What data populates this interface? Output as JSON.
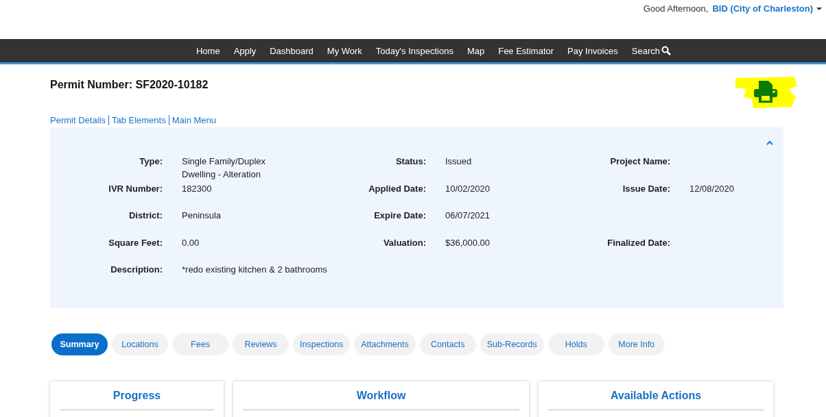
{
  "greeting": {
    "text": "Good Afternoon,",
    "user": "BID (City of Charleston)"
  },
  "nav": [
    {
      "label": "Home"
    },
    {
      "label": "Apply"
    },
    {
      "label": "Dashboard"
    },
    {
      "label": "My Work"
    },
    {
      "label": "Today's Inspections"
    },
    {
      "label": "Map"
    },
    {
      "label": "Fee Estimator"
    },
    {
      "label": "Pay Invoices"
    },
    {
      "label": "Search",
      "kind": "search"
    }
  ],
  "permit_title": "Permit Number: SF2020-10182",
  "links": [
    "Permit Details",
    "Tab Elements",
    "Main Menu"
  ],
  "details": {
    "expanded": true,
    "rows": [
      [
        {
          "label": "Type:",
          "value": "Single Family/Duplex Dwelling - Alteration"
        },
        {
          "label": "Status:",
          "value": "Issued"
        },
        {
          "label": "Project Name:"
        }
      ],
      [
        {
          "label": "IVR Number:",
          "value": "182300"
        },
        {
          "label": "Applied Date:",
          "value": "10/02/2020"
        },
        {
          "label": "Issue Date:",
          "value": "12/08/2020"
        }
      ],
      [
        {
          "label": "District:",
          "value": "Peninsula"
        },
        {
          "label": "Expire Date:",
          "value": "06/07/2021"
        },
        null
      ],
      [
        {
          "label": "Square Feet:",
          "value": "0.00"
        },
        {
          "label": "Valuation:",
          "value": "$36,000.00"
        },
        {
          "label": "Finalized Date:"
        }
      ],
      [
        {
          "label": "Description:",
          "value": "*redo existing kitchen & 2 bathrooms"
        },
        null,
        null
      ]
    ]
  },
  "tabs": [
    {
      "label": "Summary",
      "selected": true
    },
    {
      "label": "Locations",
      "selected": false
    },
    {
      "label": "Fees",
      "selected": false
    },
    {
      "label": "Reviews",
      "selected": false
    },
    {
      "label": "Inspections",
      "selected": false
    },
    {
      "label": "Attachments",
      "selected": false
    },
    {
      "label": "Contacts",
      "selected": false
    },
    {
      "label": "Sub-Records",
      "selected": false
    },
    {
      "label": "Holds",
      "selected": false
    },
    {
      "label": "More Info",
      "selected": false
    }
  ],
  "cards": [
    {
      "title": "Progress"
    },
    {
      "title": "Workflow"
    },
    {
      "title": "Available Actions"
    }
  ]
}
